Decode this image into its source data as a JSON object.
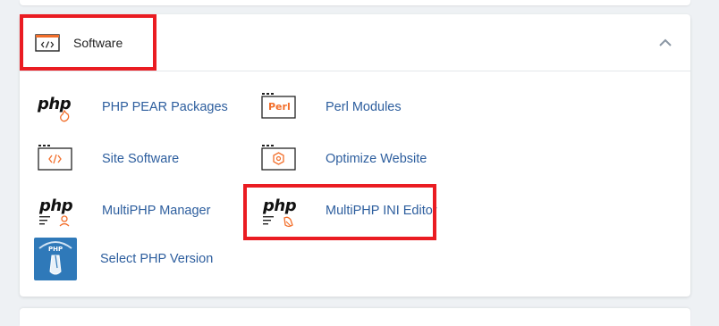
{
  "section": {
    "title": "Software",
    "icon": "code-window-icon",
    "collapse_icon": "chevron-up-icon"
  },
  "items": [
    {
      "label": "PHP PEAR Packages",
      "icon": "php-pear-icon"
    },
    {
      "label": "Perl Modules",
      "icon": "perl-icon",
      "badge": "Perl"
    },
    {
      "label": "Site Software",
      "icon": "code-window-icon"
    },
    {
      "label": "Optimize Website",
      "icon": "optimize-website-icon"
    },
    {
      "label": "MultiPHP Manager",
      "icon": "multiphp-manager-icon"
    },
    {
      "label": "MultiPHP INI Editor",
      "icon": "multiphp-ini-editor-icon"
    },
    {
      "label": "Select PHP Version",
      "icon": "select-php-version-icon",
      "badge": "PHP"
    }
  ],
  "logo_text": {
    "php": "php"
  },
  "colors": {
    "link": "#2d5e9e",
    "accent": "#f26e2a",
    "highlight": "#ea1c22",
    "php_badge_bg": "#2f79b9"
  }
}
